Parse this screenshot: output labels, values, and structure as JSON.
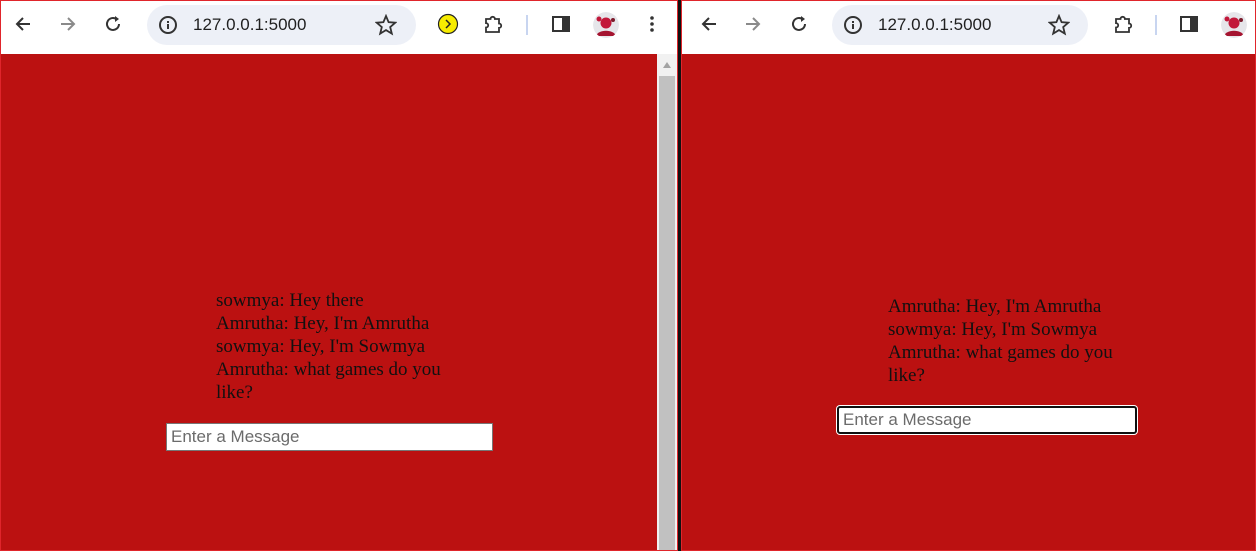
{
  "colors": {
    "page_background": "#bb1111",
    "window_border": "#e0252b",
    "omnibox": "#edf0f7",
    "chat_text": "#111111"
  },
  "left_window": {
    "url": "127.0.0.1:5000",
    "toolbar_icons": [
      "back-arrow-icon",
      "forward-arrow-icon",
      "reload-icon",
      "site-info-icon",
      "bookmark-star-icon",
      "yellow-extension-icon",
      "puzzle-extensions-icon",
      "side-panel-icon",
      "profile-avatar",
      "kebab-menu-icon"
    ],
    "messages": [
      "sowmya: Hey there",
      "Amrutha: Hey, I'm Amrutha",
      "sowmya: Hey, I'm Sowmya",
      "Amrutha: what games do you like?"
    ],
    "input": {
      "placeholder": "Enter a Message",
      "value": ""
    }
  },
  "right_window": {
    "url": "127.0.0.1:5000",
    "toolbar_icons": [
      "back-arrow-icon",
      "forward-arrow-icon",
      "reload-icon",
      "site-info-icon",
      "bookmark-star-icon",
      "puzzle-extensions-icon",
      "side-panel-icon",
      "profile-avatar"
    ],
    "messages": [
      "Amrutha: Hey, I'm Amrutha",
      "sowmya: Hey, I'm Sowmya",
      "Amrutha: what games do you like?"
    ],
    "input": {
      "placeholder": "Enter a Message",
      "value": "",
      "focused": true
    }
  }
}
